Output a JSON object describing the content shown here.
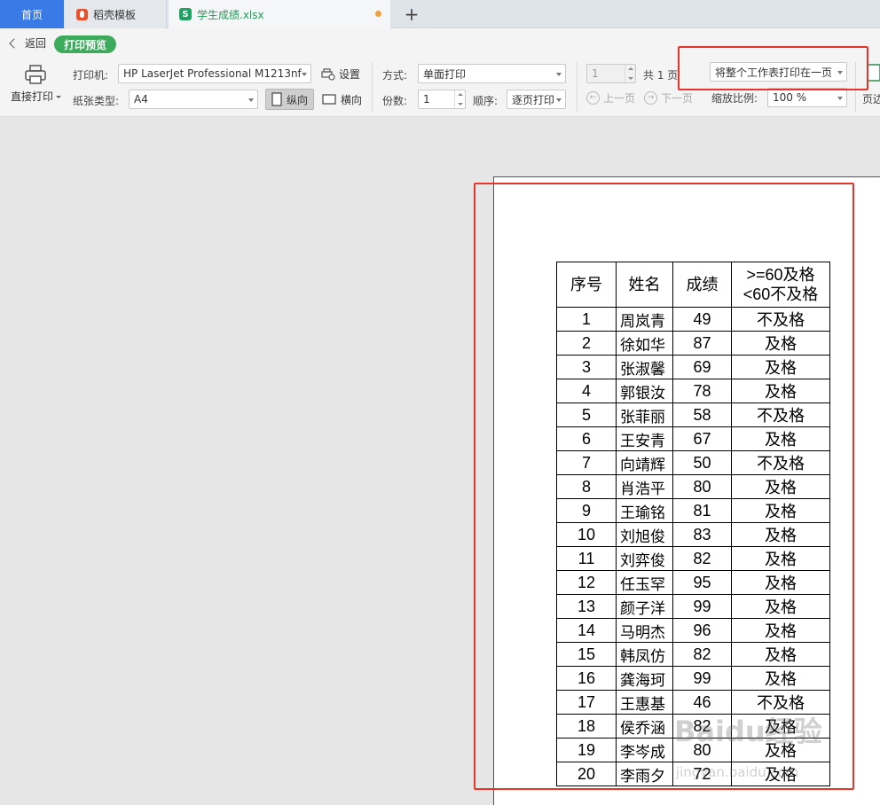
{
  "tabs": {
    "home": "首页",
    "template": "稻壳模板",
    "file": "学生成绩.xlsx",
    "add": "+"
  },
  "toolbar": {
    "back": "返回",
    "print_preview": "打印预览",
    "direct_print": "直接打印",
    "printer_label": "打印机:",
    "printer_value": "HP LaserJet Professional M1213nf",
    "settings": "设置",
    "paper_label": "纸张类型:",
    "paper_value": "A4",
    "portrait": "纵向",
    "landscape": "横向",
    "mode_label": "方式:",
    "mode_value": "单面打印",
    "copies_label": "份数:",
    "copies_value": "1",
    "order_label": "顺序:",
    "order_value": "逐页打印",
    "page_value": "1",
    "page_total": "共 1 页",
    "prev_page": "上一页",
    "next_page": "下一页",
    "fit_value": "将整个工作表打印在一页",
    "zoom_label": "缩放比例:",
    "zoom_value": "100 %",
    "margin": "页边"
  },
  "sheet": {
    "headers": [
      "序号",
      "姓名",
      "成绩",
      ">=60及格\n<60不及格"
    ],
    "rows": [
      [
        "1",
        "周岚青",
        "49",
        "不及格"
      ],
      [
        "2",
        "徐如华",
        "87",
        "及格"
      ],
      [
        "3",
        "张淑馨",
        "69",
        "及格"
      ],
      [
        "4",
        "郭银汝",
        "78",
        "及格"
      ],
      [
        "5",
        "张菲丽",
        "58",
        "不及格"
      ],
      [
        "6",
        "王安青",
        "67",
        "及格"
      ],
      [
        "7",
        "向靖辉",
        "50",
        "不及格"
      ],
      [
        "8",
        "肖浩平",
        "80",
        "及格"
      ],
      [
        "9",
        "王瑜铭",
        "81",
        "及格"
      ],
      [
        "10",
        "刘旭俊",
        "83",
        "及格"
      ],
      [
        "11",
        "刘弈俊",
        "82",
        "及格"
      ],
      [
        "12",
        "任玉罕",
        "95",
        "及格"
      ],
      [
        "13",
        "颜子洋",
        "99",
        "及格"
      ],
      [
        "14",
        "马明杰",
        "96",
        "及格"
      ],
      [
        "15",
        "韩凤仿",
        "82",
        "及格"
      ],
      [
        "16",
        "龚海珂",
        "99",
        "及格"
      ],
      [
        "17",
        "王惠基",
        "46",
        "不及格"
      ],
      [
        "18",
        "侯乔涵",
        "82",
        "及格"
      ],
      [
        "19",
        "李岑成",
        "80",
        "及格"
      ],
      [
        "20",
        "李雨夕",
        "72",
        "及格"
      ]
    ]
  },
  "watermark": {
    "logo": "Baidu经验",
    "url": "jingyan.baidu.com"
  },
  "colors": {
    "accent_blue": "#3a7ae6",
    "preview_green": "#3dab5b",
    "highlight_red": "#e8342b"
  }
}
